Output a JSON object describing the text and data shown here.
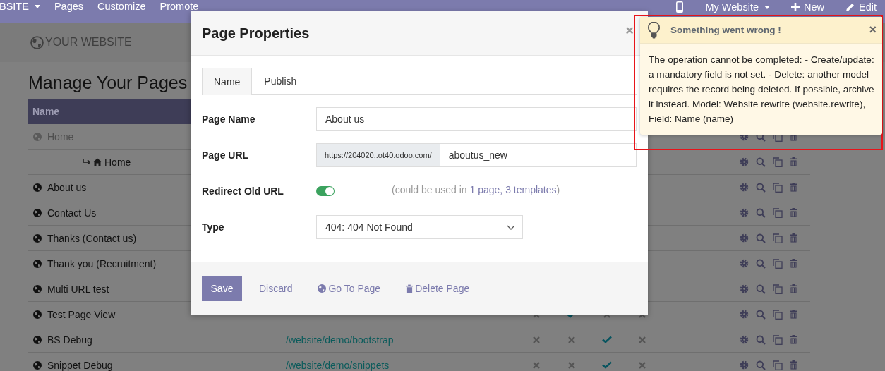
{
  "navbar": {
    "menus": [
      {
        "label": "BSITE",
        "dropdown": true
      },
      {
        "label": "Pages",
        "dropdown": false
      },
      {
        "label": "Customize",
        "dropdown": false
      },
      {
        "label": "Promote",
        "dropdown": false
      }
    ],
    "right": [
      {
        "kind": "device"
      },
      {
        "kind": "dropdown",
        "label": "My Website"
      },
      {
        "kind": "new",
        "label": "New"
      },
      {
        "kind": "edit",
        "label": "Edit"
      }
    ]
  },
  "site": {
    "logo_text": "YOUR WEBSITE"
  },
  "heading": "Manage Your Pages",
  "table": {
    "columns": [
      "Name"
    ],
    "rows": [
      {
        "name": "Home",
        "published": false,
        "children": [
          {
            "name": "Home"
          }
        ]
      },
      {
        "name": "About us",
        "published": true
      },
      {
        "name": "Contact Us",
        "published": true
      },
      {
        "name": "Thanks (Contact us)",
        "published": true
      },
      {
        "name": "Thank you (Recruitment)",
        "published": true
      },
      {
        "name": "Multi URL test",
        "published": true
      },
      {
        "name": "Test Page View",
        "published": true,
        "marks": [
          false,
          true,
          false,
          false
        ]
      },
      {
        "name": "BS Debug",
        "published": true,
        "url": "/website/demo/bootstrap",
        "marks": [
          false,
          false,
          true,
          false
        ]
      },
      {
        "name": "Snippet Debug",
        "published": true,
        "url": "/website/demo/snippets",
        "marks": [
          false,
          false,
          true,
          false
        ]
      }
    ]
  },
  "modal": {
    "title": "Page Properties",
    "close": "×",
    "tabs": [
      {
        "label": "Name",
        "selected": true
      },
      {
        "label": "Publish",
        "selected": false
      }
    ],
    "fields": [
      {
        "kind": "text",
        "label": "Page Name",
        "value": "About us"
      },
      {
        "kind": "url",
        "label": "Page URL",
        "prefix": "https://204020..ot40.odoo.com/",
        "value": "aboutus_new"
      },
      {
        "kind": "toggle",
        "label": "Redirect Old URL",
        "on": true,
        "note": "(could be used in ",
        "link": "1 page, 3 templates",
        "note_end": ")"
      },
      {
        "kind": "select",
        "label": "Type",
        "value": "404: 404 Not Found"
      }
    ],
    "buttons": [
      {
        "kind": "primary",
        "label": "Save"
      },
      {
        "kind": "link",
        "label": "Discard"
      },
      {
        "kind": "globe",
        "label": "Go To Page"
      },
      {
        "kind": "trash",
        "label": "Delete Page"
      }
    ]
  },
  "notification": {
    "title": "Something went wrong !",
    "close": "×",
    "highlighted": true,
    "message": "The operation cannot be completed: - Create/update: a mandatory field is not set. - Delete: another model requires the record being deleted. If possible, archive it instead. Model: Website rewrite (website.rewrite), Field: Name (name)"
  }
}
